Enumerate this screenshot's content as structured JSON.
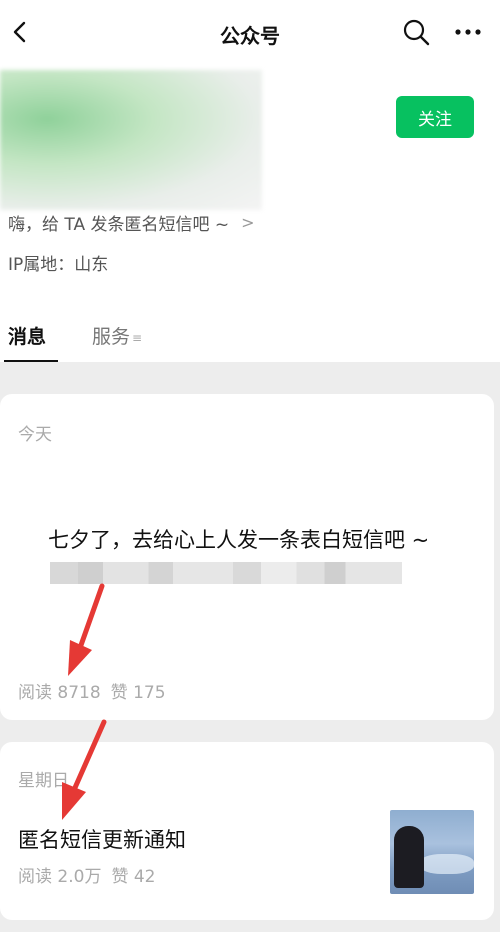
{
  "header": {
    "title": "公众号",
    "back_icon": "chevron-left-icon",
    "search_icon": "search-icon",
    "more_icon": "more-dots-icon"
  },
  "profile": {
    "follow_label": "关注",
    "intro": "嗨，给 TA 发条匿名短信吧 ~",
    "ip": "IP属地：山东",
    "accent": "#07c160"
  },
  "tabs": [
    {
      "label": "消息",
      "active": true
    },
    {
      "label": "服务",
      "active": false
    }
  ],
  "messages": [
    {
      "date": "今天",
      "title": "七夕了，去给心上人发一条表白短信吧 ~",
      "reads": "阅读 8718",
      "likes": "赞 175"
    },
    {
      "date": "星期日",
      "title": "匿名短信更新通知",
      "reads": "阅读 2.0万",
      "likes": "赞 42"
    }
  ],
  "annotation_color": "#e53935"
}
